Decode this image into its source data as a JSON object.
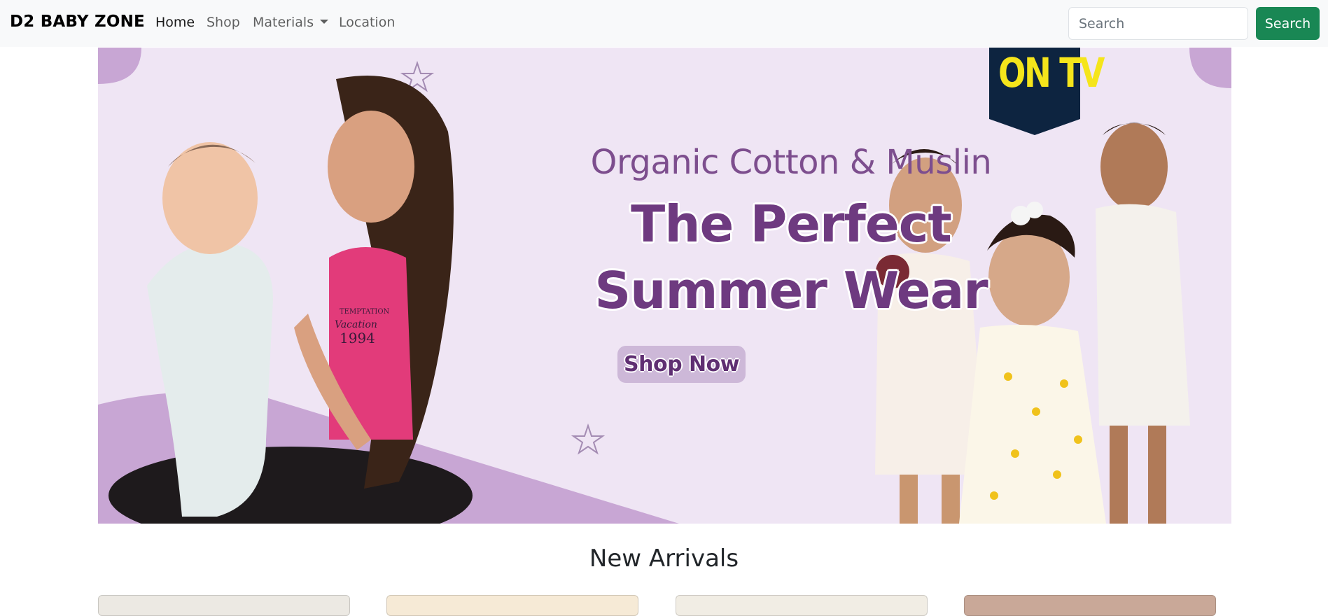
{
  "navbar": {
    "brand": "D2 BABY ZONE",
    "links": [
      {
        "label": "Home",
        "active": true
      },
      {
        "label": "Shop",
        "active": false
      },
      {
        "label": "Materials",
        "dropdown": true
      },
      {
        "label": "Location",
        "active": false
      }
    ],
    "search": {
      "placeholder": "Search",
      "value": ""
    },
    "search_button": "Search",
    "accent_color": "#198754"
  },
  "hero": {
    "subtitle": "Organic Cotton & Muslin",
    "title_line1": "The Perfect",
    "title_line2": "Summer Wear",
    "cta": "Shop Now",
    "badge": "ON TV",
    "tshirt_print_line1": "TEMPTATION",
    "tshirt_print_line2": "Vacation",
    "tshirt_print_line3": "1994",
    "colors": {
      "background": "#efe5f4",
      "title": "#6e3a80",
      "accent": "#c8a6d4"
    }
  },
  "new_arrivals": {
    "title": "New Arrivals",
    "cards": [
      {
        "bg": "#ece9e3"
      },
      {
        "bg": "#f6ead6"
      },
      {
        "bg": "#f1ede4"
      },
      {
        "bg": "#c9a898"
      }
    ]
  }
}
